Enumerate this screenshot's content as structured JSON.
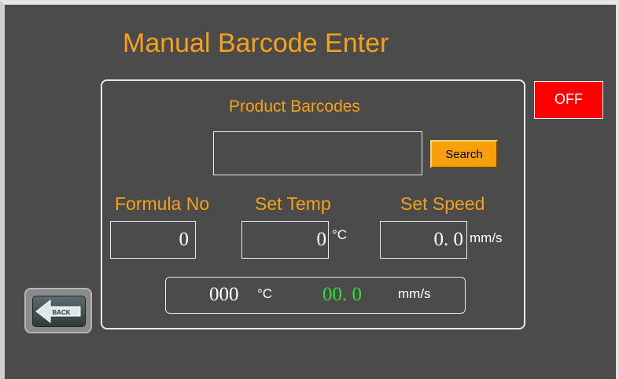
{
  "title": "Manual Barcode Enter",
  "product_barcodes_label": "Product Barcodes",
  "barcode_input_value": "",
  "search_label": "Search",
  "off_label": "OFF",
  "formula_no_label": "Formula No",
  "set_temp_label": "Set Temp",
  "set_speed_label": "Set Speed",
  "formula_no_value": "0",
  "set_temp_value": "0",
  "set_temp_unit": "°C",
  "set_speed_value": "0. 0",
  "set_speed_unit": "mm/s",
  "current_temp_value": "000",
  "current_temp_unit": "°C",
  "current_speed_value": "00. 0",
  "current_speed_unit": "mm/s",
  "back_label": "BACK",
  "colors": {
    "accent": "#f7a11a",
    "off": "#ff0000",
    "speed_readout": "#2ee02e",
    "background": "#4b4b4b"
  }
}
